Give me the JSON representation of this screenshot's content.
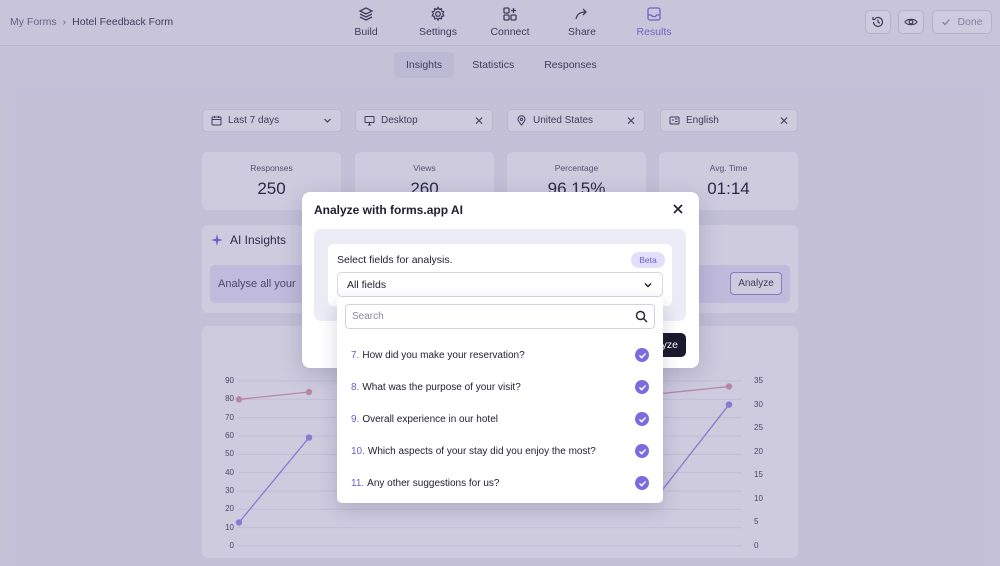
{
  "breadcrumb": {
    "parent": "My Forms",
    "separator": "›",
    "current": "Hotel Feedback Form"
  },
  "nav": {
    "tabs": [
      {
        "label": "Build",
        "icon": "layers-icon"
      },
      {
        "label": "Settings",
        "icon": "gear-icon"
      },
      {
        "label": "Connect",
        "icon": "add-square-icon"
      },
      {
        "label": "Share",
        "icon": "share-arrow-icon"
      },
      {
        "label": "Results",
        "icon": "inbox-icon",
        "active": true
      }
    ],
    "done_label": "Done"
  },
  "subtabs": [
    "Insights",
    "Statistics",
    "Responses"
  ],
  "filters": {
    "date": "Last 7 days",
    "device": "Desktop",
    "country": "United States",
    "language": "English"
  },
  "stats": [
    {
      "label": "Responses",
      "value": "250"
    },
    {
      "label": "Views",
      "value": "260"
    },
    {
      "label": "Percentage",
      "value": "96.15%"
    },
    {
      "label": "Avg. Time",
      "value": "01:14"
    }
  ],
  "ai_insights": {
    "title": "AI Insights",
    "prompt_text": "Analyse all your",
    "analyze_label": "Analyze"
  },
  "chart_data": {
    "type": "line",
    "y_left_ticks": [
      "90",
      "80",
      "70",
      "60",
      "50",
      "40",
      "30",
      "20",
      "10",
      "0"
    ],
    "y_right_ticks": [
      "35",
      "30",
      "25",
      "20",
      "15",
      "10",
      "5",
      "0"
    ],
    "ylim_left": [
      0,
      90
    ],
    "ylim_right": [
      0,
      35
    ],
    "grid": true,
    "series": [
      {
        "color": "#e2a0b0",
        "axis": "left",
        "visible_points": [
          {
            "x": 0,
            "y": 80
          },
          {
            "x": 1,
            "y": 84
          },
          {
            "x": 6,
            "y": 83
          },
          {
            "x": 7,
            "y": 87
          }
        ]
      },
      {
        "color": "#9e8fe8",
        "axis": "right",
        "visible_points": [
          {
            "x": 0,
            "y": 5
          },
          {
            "x": 1,
            "y": 23
          },
          {
            "x": 6,
            "y": 11
          },
          {
            "x": 7,
            "y": 30
          }
        ]
      }
    ]
  },
  "modal": {
    "title": "Analyze with forms.app AI",
    "field_label": "Select fields for analysis.",
    "badge": "Beta",
    "select_value": "All fields",
    "search_placeholder": "Search",
    "analyze_label": "yze",
    "options": [
      {
        "num": "7.",
        "label": "How did you make your reservation?",
        "checked": true
      },
      {
        "num": "8.",
        "label": "What was the purpose of your visit?",
        "checked": true
      },
      {
        "num": "9.",
        "label": "Overall experience in our hotel",
        "checked": true
      },
      {
        "num": "10.",
        "label": "Which aspects of your stay did you enjoy the most?",
        "checked": true
      },
      {
        "num": "11.",
        "label": "Any other suggestions for us?",
        "checked": true
      }
    ]
  },
  "colors": {
    "accent": "#7b6be0",
    "overlay": "#4e448c"
  }
}
